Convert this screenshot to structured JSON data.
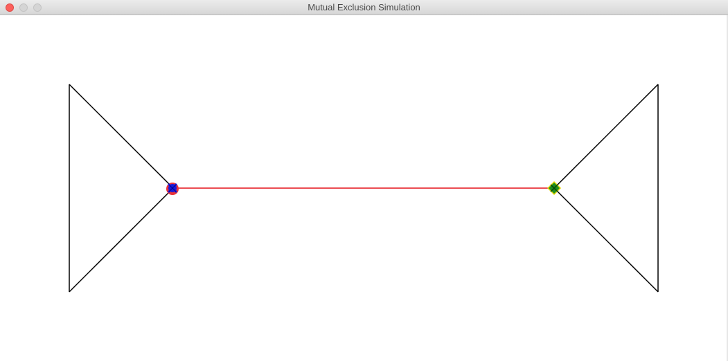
{
  "window": {
    "title": "Mutual Exclusion Simulation"
  },
  "colors": {
    "track": "#000000",
    "shared_segment": "#e8323a",
    "left_agent_outer": "#e8323a",
    "left_agent_inner": "#1a1ad9",
    "right_agent_outer": "#e6d600",
    "right_agent_inner": "#1f8f1f"
  },
  "icons": {
    "left_agent": "circle-with-cross-icon",
    "right_agent": "diamond-with-cross-icon"
  }
}
